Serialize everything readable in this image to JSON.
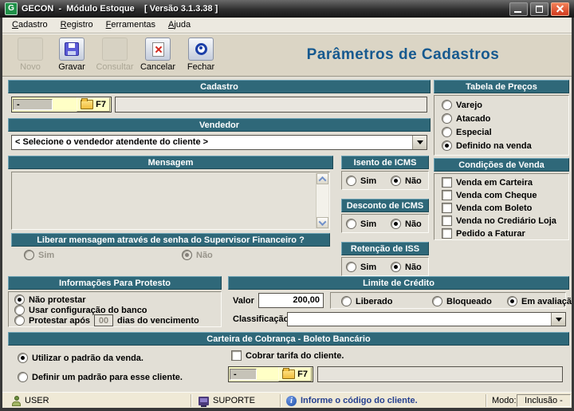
{
  "window": {
    "title": "GECON  -  Módulo Estoque    [ Versão 3.1.3.38 ]",
    "logo_letter": "G"
  },
  "menu": {
    "items": [
      {
        "key": "C",
        "rest": "adastro"
      },
      {
        "key": "R",
        "rest": "egistro"
      },
      {
        "key": "F",
        "rest": "erramentas"
      },
      {
        "key": "A",
        "rest": "juda"
      }
    ]
  },
  "toolbar": {
    "form_title": "Parâmetros de Cadastros",
    "buttons": [
      {
        "label": "Novo",
        "disabled": true
      },
      {
        "label": "Gravar",
        "disabled": false
      },
      {
        "label": "Consultar",
        "disabled": true
      },
      {
        "label": "Cancelar",
        "disabled": false
      },
      {
        "label": "Fechar",
        "disabled": false
      }
    ]
  },
  "cadastro": {
    "title": "Cadastro",
    "code": "-",
    "f7": "F7",
    "value": ""
  },
  "vendedor": {
    "title": "Vendedor",
    "selected": "< Selecione o vendedor atendente do cliente >"
  },
  "mensagem": {
    "title": "Mensagem",
    "text": "",
    "liberar_title": "Liberar mensagem através de senha do Supervisor Financeiro ?",
    "sim": "Sim",
    "nao": "Não",
    "selected": "Não",
    "enabled": false
  },
  "isento_icms": {
    "title": "Isento de ICMS",
    "sim": "Sim",
    "nao": "Não",
    "selected": "Não"
  },
  "desconto_icms": {
    "title": "Desconto de ICMS",
    "sim": "Sim",
    "nao": "Não",
    "selected": "Não"
  },
  "retencao_iss": {
    "title": "Retenção de ISS",
    "sim": "Sim",
    "nao": "Não",
    "selected": "Não"
  },
  "tabela_precos": {
    "title": "Tabela de Preços",
    "options": [
      "Varejo",
      "Atacado",
      "Especial",
      "Definido na venda"
    ],
    "selected": "Definido na venda"
  },
  "condicoes_venda": {
    "title": "Condições de Venda",
    "options": [
      "Venda em Carteira",
      "Venda com Cheque",
      "Venda com Boleto",
      "Venda no Crediário Loja",
      "Pedido a Faturar"
    ],
    "checked": []
  },
  "protesto": {
    "title": "Informações Para Protesto",
    "opt1": "Não protestar",
    "opt2": "Usar configuração do banco",
    "opt3_prefix": "Protestar após",
    "dias": "00",
    "opt3_suffix": "dias do vencimento",
    "selected": "Não protestar"
  },
  "limite": {
    "title": "Limite de Crédito",
    "valor_label": "Valor",
    "valor": "200,00",
    "options": [
      "Liberado",
      "Bloqueado",
      "Em avaliação"
    ],
    "selected": "Em avaliação",
    "classificacao_label": "Classificação",
    "classificacao": ""
  },
  "carteira": {
    "title": "Carteira de Cobrança - Boleto Bancário",
    "opt1": "Utilizar o padrão da venda.",
    "opt2": "Definir um padrão para esse cliente.",
    "selected": "Utilizar o padrão da venda.",
    "checkbox": "Cobrar tarifa do cliente.",
    "checkbox_checked": false,
    "code": "-",
    "f7": "F7",
    "value": ""
  },
  "statusbar": {
    "user": "USER",
    "station": "SUPORTE",
    "message": "Informe o código do cliente.",
    "mode_label": "Modo:",
    "mode": "Inclusão -"
  },
  "colors": {
    "header_teal": "#2F6879",
    "title_blue": "#16598F",
    "lookup_yellow": "#FFFFC6",
    "close_red": "#D23B1F"
  }
}
